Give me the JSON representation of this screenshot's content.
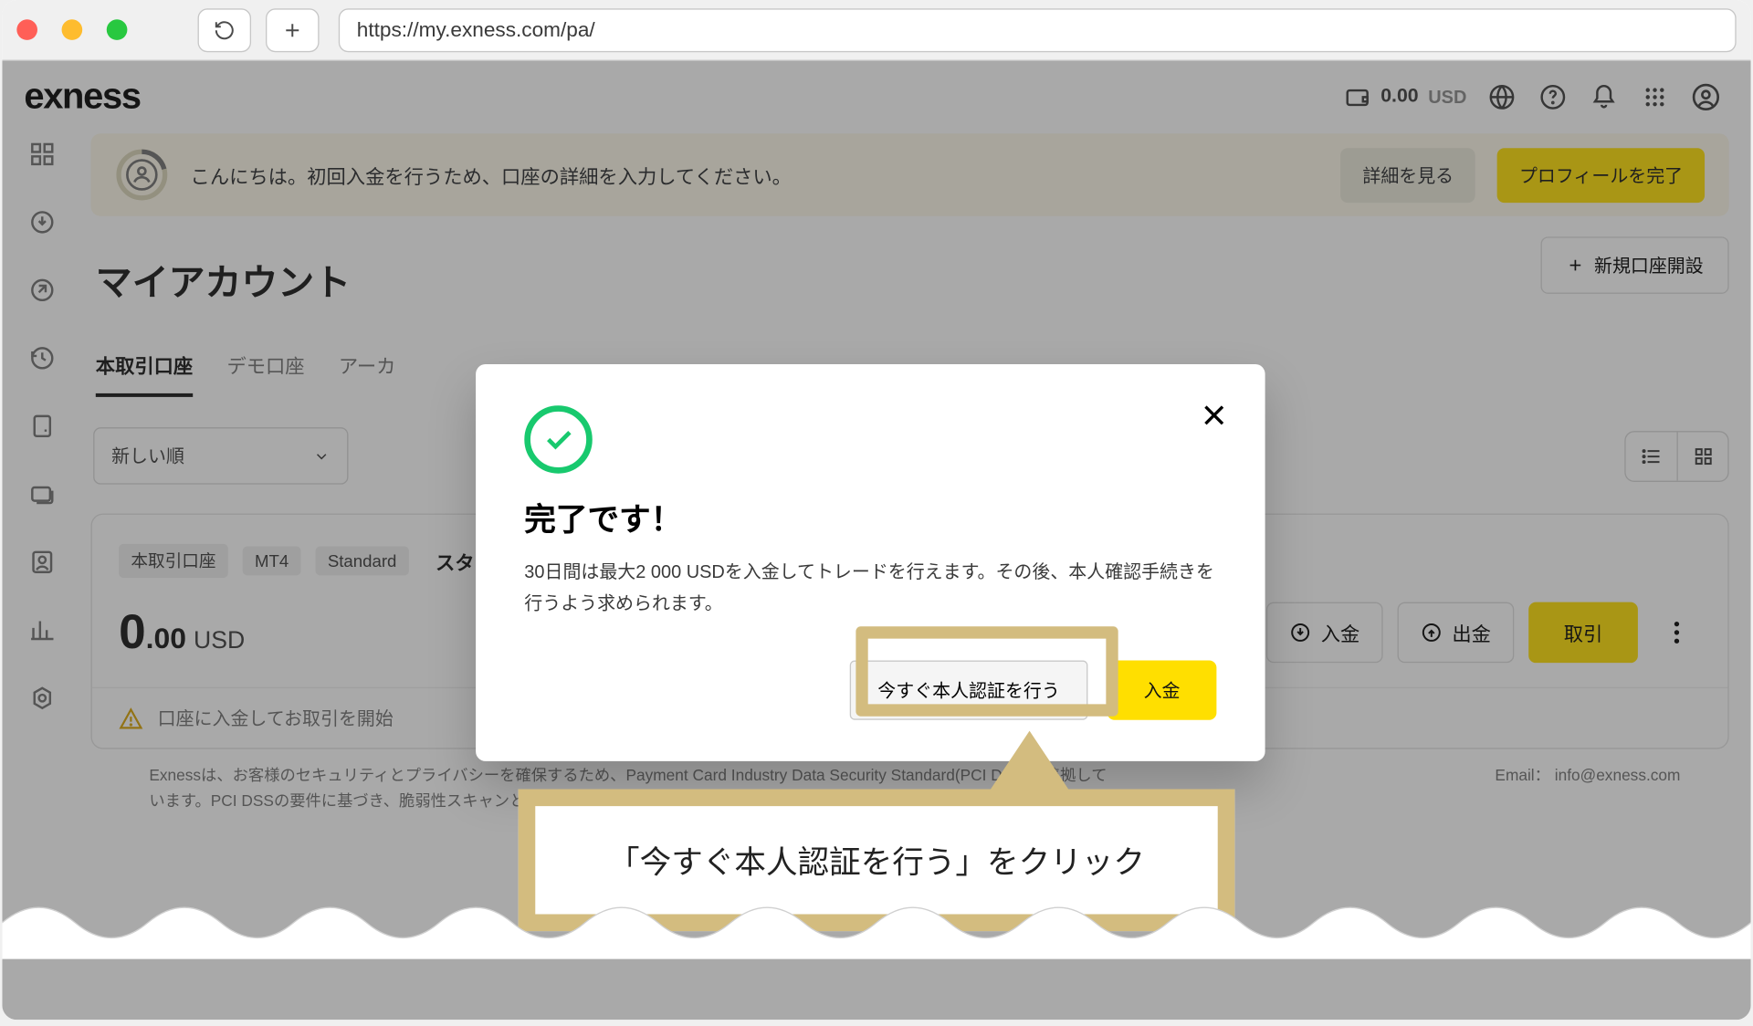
{
  "browser": {
    "url": "https://my.exness.com/pa/"
  },
  "brand": "exness",
  "balance": {
    "amount": "0.00",
    "currency": "USD"
  },
  "banner": {
    "text": "こんにちは。初回入金を行うため、口座の詳細を入力してください。",
    "detail_btn": "詳細を見る",
    "complete_btn": "プロフィールを完了"
  },
  "page_title": "マイアカウント",
  "new_account_btn": "新規口座開設",
  "tabs": {
    "real": "本取引口座",
    "demo": "デモ口座",
    "archive": "アーカ"
  },
  "sort_select": "新しい順",
  "account": {
    "tags": {
      "real": "本取引口座",
      "mt4": "MT4",
      "standard": "Standard",
      "name": "スタ"
    },
    "balance_int": "0",
    "balance_dec": ".00",
    "balance_cur": "USD",
    "deposit": "入金",
    "withdraw": "出金",
    "trade": "取引",
    "info": "口座に入金してお取引を開始"
  },
  "footer": {
    "left": "Exnessは、お客様のセキュリティとプライバシーを確保するため、Payment Card Industry Data Security Standard(PCI DSS)に準拠しています。PCI DSSの要件に基づき、脆弱性スキャンと侵入テストを定期的に実施しています。",
    "email_label": "Email：",
    "email": "info@exness.com"
  },
  "modal": {
    "title": "完了です！",
    "body": "30日間は最大2 000 USDを入金してトレードを行えます。その後、本人確認手続きを行うよう求められます。",
    "verify_btn": "今すぐ本人認証を行う",
    "deposit_btn": "入金"
  },
  "callout": "「今すぐ本人認証を行う」をクリック"
}
